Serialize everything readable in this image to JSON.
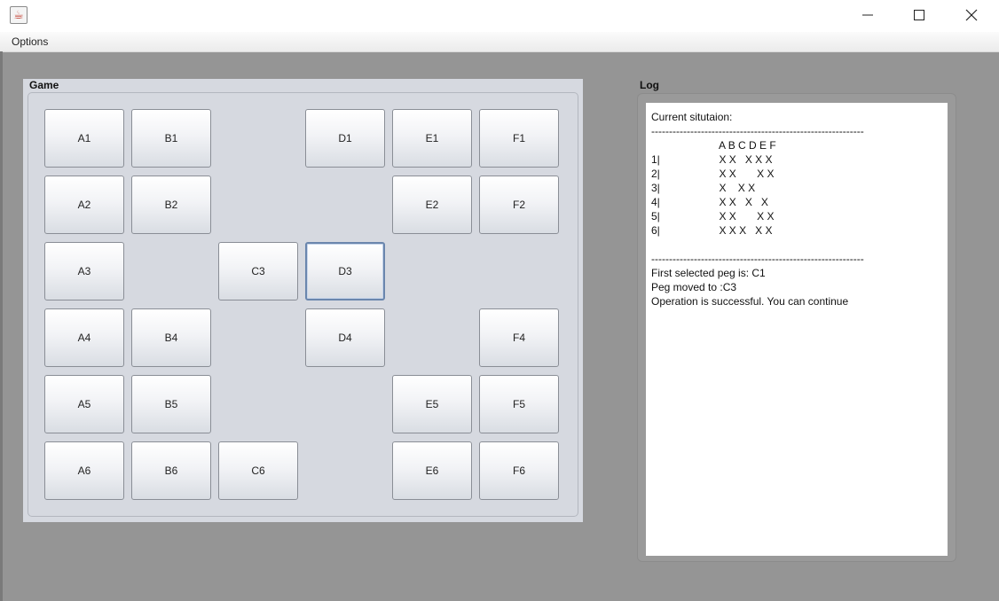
{
  "window": {
    "close_glyph": "close-icon",
    "max_glyph": "maximize-icon",
    "min_glyph": "minimize-icon",
    "icon": "java-cup-icon"
  },
  "menu": {
    "options_label": "Options"
  },
  "game": {
    "title": "Game",
    "rows": [
      [
        "A1",
        "B1",
        "",
        "D1",
        "E1",
        "F1"
      ],
      [
        "A2",
        "B2",
        "",
        "",
        "E2",
        "F2"
      ],
      [
        "A3",
        "",
        "C3",
        "D3",
        "",
        ""
      ],
      [
        "A4",
        "B4",
        "",
        "D4",
        "",
        "F4"
      ],
      [
        "A5",
        "B5",
        "",
        "",
        "E5",
        "F5"
      ],
      [
        "A6",
        "B6",
        "C6",
        "",
        "E6",
        "F6"
      ]
    ],
    "focused": "D3"
  },
  "log": {
    "title": "Log",
    "text": "Current situtaion:\n------------------------------------------------------------\n                       A B C D E F\n1|                    X X   X X X\n2|                    X X       X X\n3|                    X    X X\n4|                    X X   X   X\n5|                    X X       X X\n6|                    X X X   X X\n\n------------------------------------------------------------\nFirst selected peg is: C1\nPeg moved to :C3\nOperation is successful. You can continue"
  }
}
